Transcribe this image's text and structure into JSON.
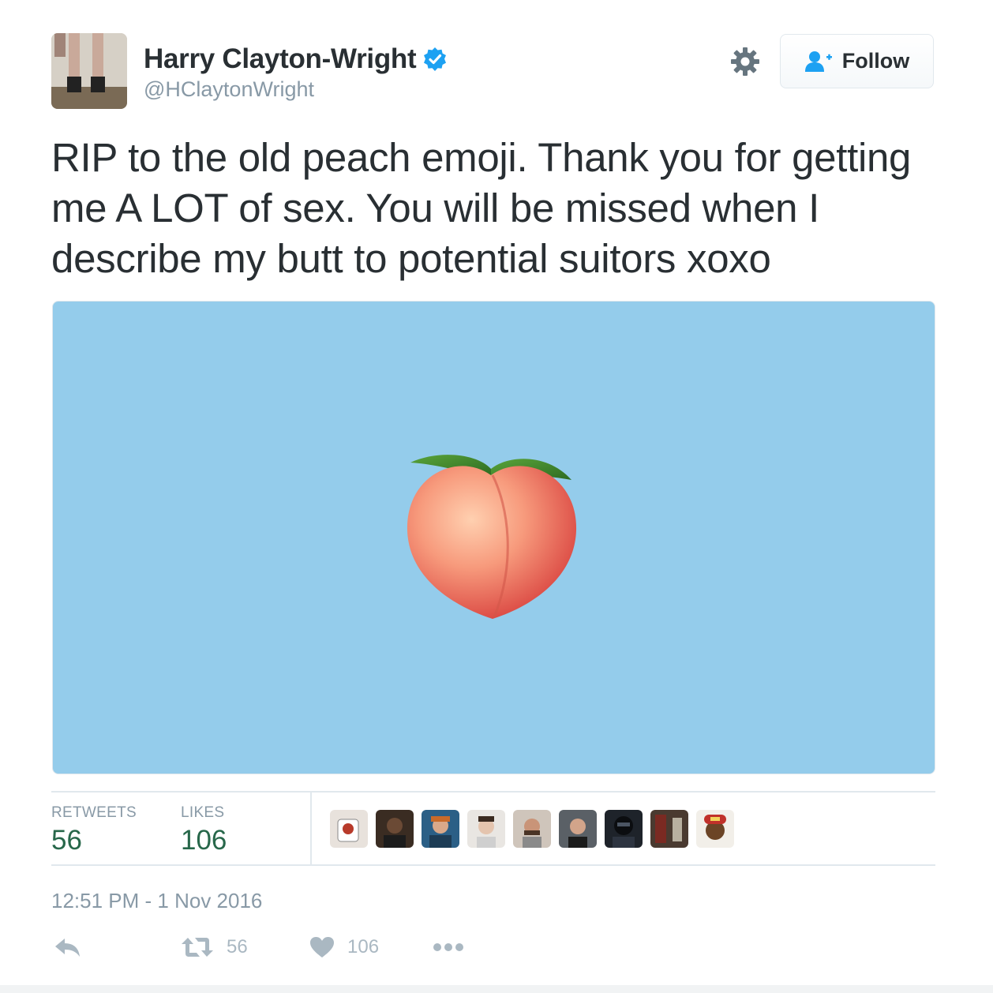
{
  "author": {
    "display_name": "Harry Clayton-Wright",
    "handle": "@HClaytonWright",
    "verified": true
  },
  "header": {
    "follow_label": "Follow",
    "settings_icon": "gear-icon",
    "follow_icon": "add-user-icon"
  },
  "tweet": {
    "text": "RIP to the old peach emoji. Thank you for getting me A LOT of sex. You will be missed when I describe my butt to potential suitors xoxo",
    "media_icon": "peach-emoji",
    "media_background": "#94cceb"
  },
  "stats": {
    "retweets_label": "RETWEETS",
    "retweets_value": "56",
    "likes_label": "LIKES",
    "likes_value": "106",
    "liker_count": 9
  },
  "timestamp": "12:51 PM - 1 Nov 2016",
  "actions": {
    "reply_icon": "reply-icon",
    "retweet_icon": "retweet-icon",
    "retweet_count": "56",
    "like_icon": "heart-icon",
    "like_count": "106",
    "more_icon": "more-icon"
  },
  "colors": {
    "verified_blue": "#1da1f2",
    "stat_green": "#27674a",
    "muted_gray": "#8899a6"
  }
}
